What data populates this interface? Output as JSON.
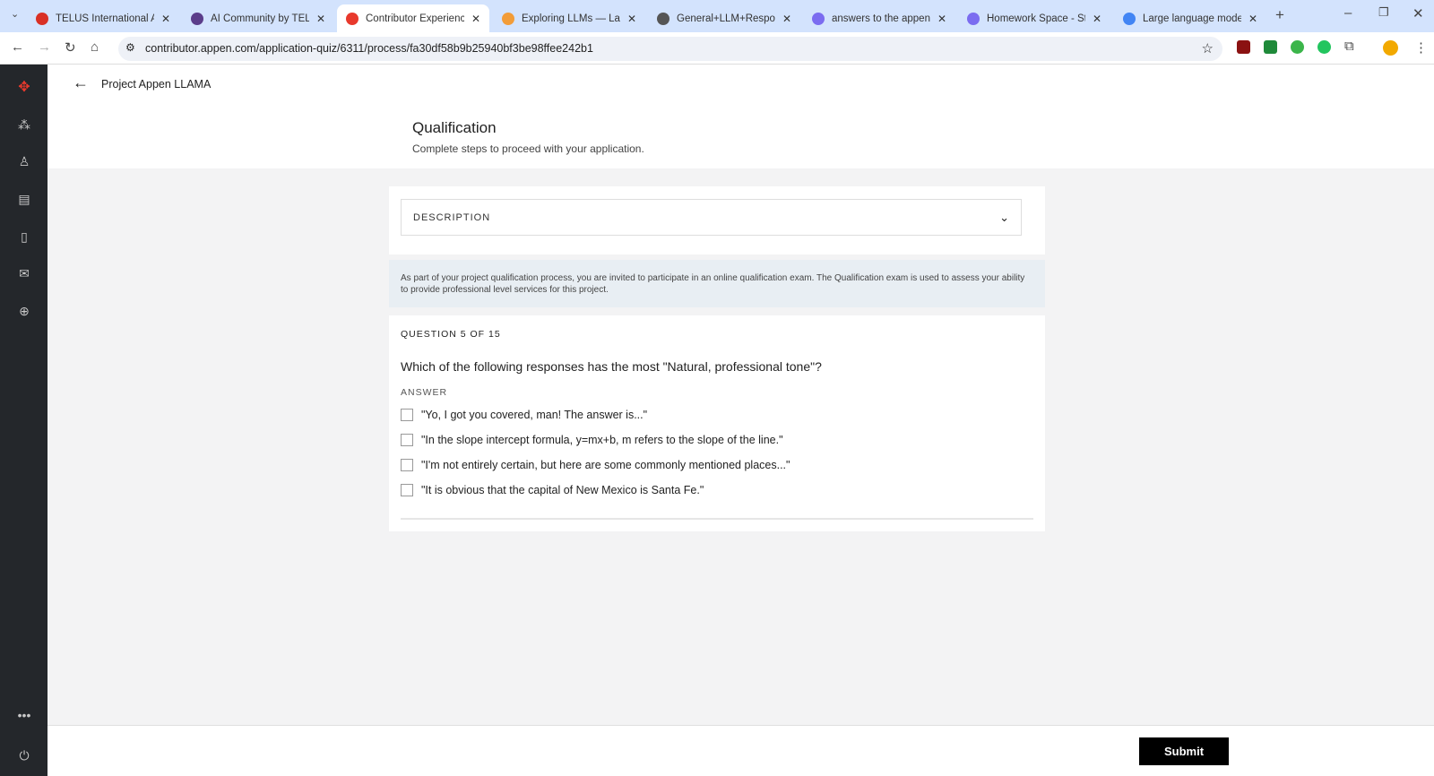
{
  "browser": {
    "tabs": [
      {
        "title": "TELUS International AI- C",
        "icon": "gmail-icon",
        "color": "#d93025"
      },
      {
        "title": "AI Community by TELUS I",
        "icon": "community-icon",
        "color": "#5b3d8a"
      },
      {
        "title": "Contributor Experience",
        "icon": "appen-icon",
        "color": "#e8392c",
        "active": true
      },
      {
        "title": "Exploring LLMs — Large I",
        "icon": "doc-icon",
        "color": "#f29c38"
      },
      {
        "title": "General+LLM+Response-",
        "icon": "globe-icon",
        "color": "#555"
      },
      {
        "title": "answers to the appen llar",
        "icon": "ai-icon",
        "color": "#7b6cf0"
      },
      {
        "title": "Homework Space - Study",
        "icon": "ai-icon",
        "color": "#7b6cf0"
      },
      {
        "title": "Large language model re",
        "icon": "google-icon",
        "color": "#4285f4"
      }
    ],
    "url": "contributor.appen.com/application-quiz/6311/process/fa30df58b9b25940bf3be98ffee242b1"
  },
  "header": {
    "back_label": "Project Appen LLAMA"
  },
  "page": {
    "title": "Qualification",
    "subtitle": "Complete steps to proceed with your application."
  },
  "description": {
    "label": "DESCRIPTION"
  },
  "info": "As part of your project qualification process, you are invited to participate in an online qualification exam. The Qualification exam is used to assess your ability to provide professional level services for this project.",
  "question": {
    "counter": "QUESTION 5 OF 15",
    "text": "Which of the following responses has the most \"Natural, professional tone\"?",
    "answer_label": "ANSWER",
    "options": [
      "\"Yo, I got you covered, man! The answer is...\"",
      "\"In the slope intercept formula, y=mx+b, m refers to the slope of the line.\"",
      "\"I'm not entirely certain, but here are some commonly mentioned places...\"",
      "\"It is obvious that the capital of New Mexico is Santa Fe.\""
    ]
  },
  "footer": {
    "submit_label": "Submit"
  },
  "colors": {
    "sidebar": "#24272b",
    "accent": "#e8392c",
    "info_bg": "#e8eef3",
    "submit": "#000000"
  }
}
